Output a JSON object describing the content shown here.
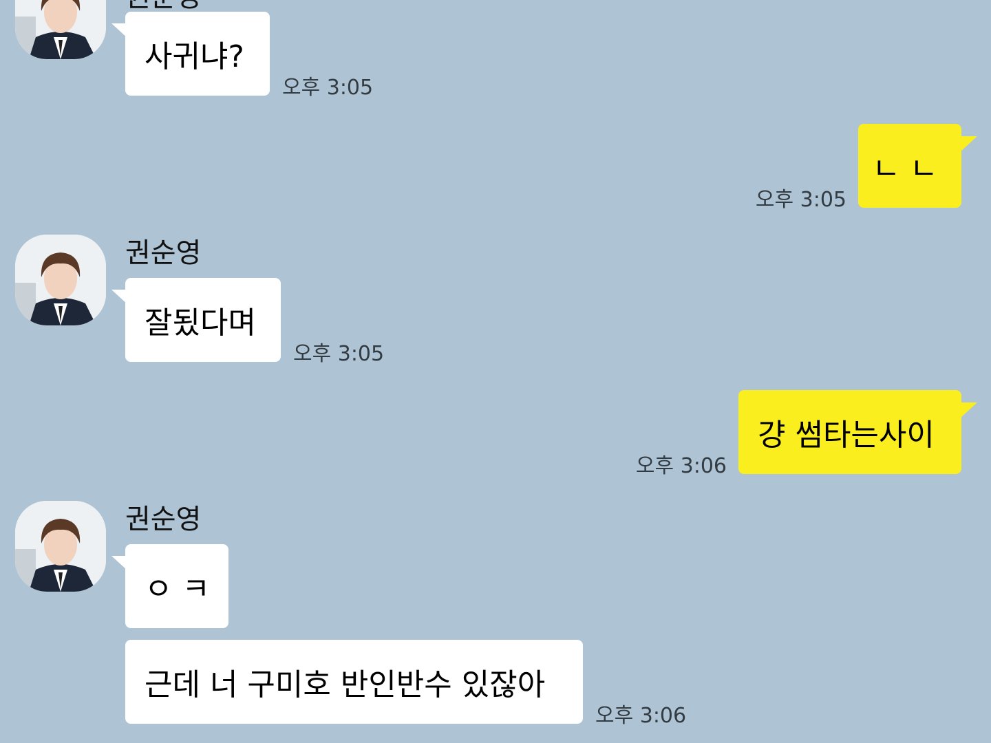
{
  "contact": {
    "name": "권순영"
  },
  "colors": {
    "background": "#aec3d3",
    "incoming_bubble": "#ffffff",
    "outgoing_bubble": "#fbee1f"
  },
  "messages": [
    {
      "sender": "contact",
      "text": "사귀냐?",
      "time": "오후 3:05"
    },
    {
      "sender": "me",
      "text": "ㄴㄴ",
      "time": "오후 3:05"
    },
    {
      "sender": "contact",
      "text": "잘됬다며",
      "time": "오후 3:05"
    },
    {
      "sender": "me",
      "text": "걍 썸타는사이",
      "time": "오후 3:06"
    },
    {
      "sender": "contact",
      "text": "ㅇㅋ",
      "time": ""
    },
    {
      "sender": "contact",
      "text": "근데 너 구미호 반인반수 있잖아",
      "time": "오후 3:06"
    }
  ]
}
